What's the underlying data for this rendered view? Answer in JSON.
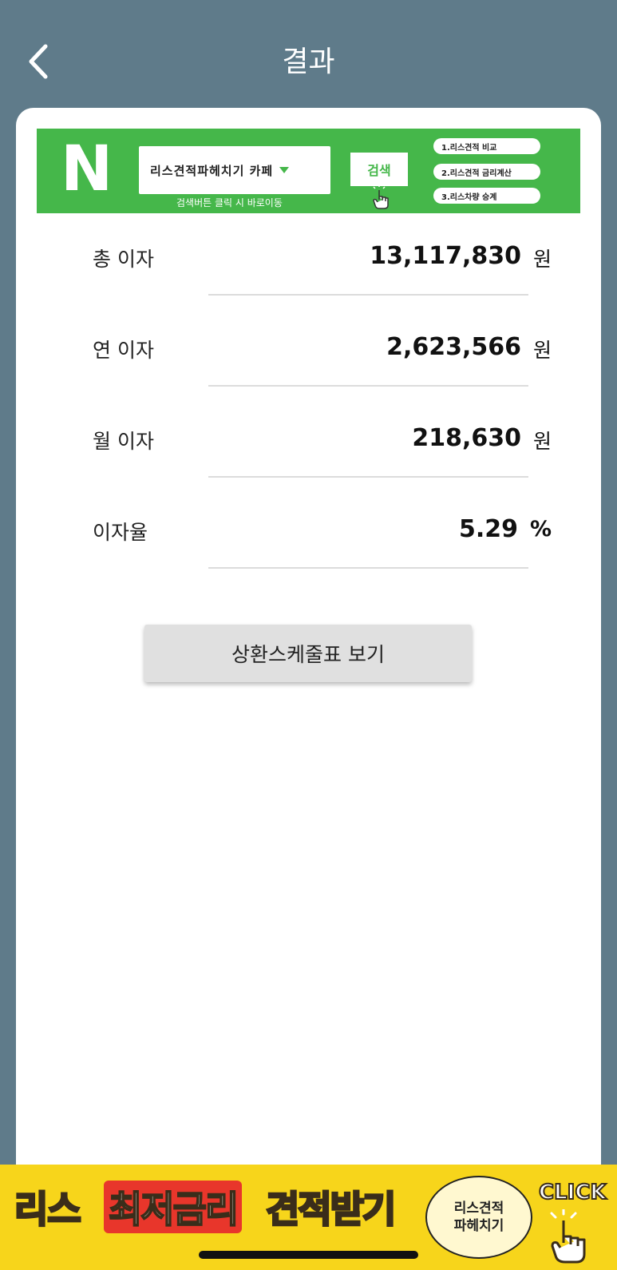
{
  "header": {
    "title": "결과"
  },
  "naver_banner": {
    "logo": "N",
    "cafe_name": "리스견적파헤치기 카페",
    "search_label": "검색",
    "search_hint": "검색버튼 클릭 시 바로이동",
    "menu": [
      "1.리스견적 비교",
      "2.리스견적 금리계산",
      "3.리스차량 승계"
    ],
    "accent_color": "#45b74a"
  },
  "results": [
    {
      "label": "총 이자",
      "value": "13,117,830",
      "unit": "원"
    },
    {
      "label": "연 이자",
      "value": "2,623,566",
      "unit": "원"
    },
    {
      "label": "월 이자",
      "value": "218,630",
      "unit": "원"
    },
    {
      "label": "이자율",
      "value": "5.29",
      "unit": "%"
    }
  ],
  "schedule_button": {
    "label": "상환스케줄표 보기"
  },
  "ad": {
    "part1": "리스",
    "part2": "최저금리",
    "part3": "견적받기",
    "circle_line1": "리스견적",
    "circle_line2": "파헤치기",
    "click_label": "CLICK",
    "background": "#f7d51b"
  }
}
